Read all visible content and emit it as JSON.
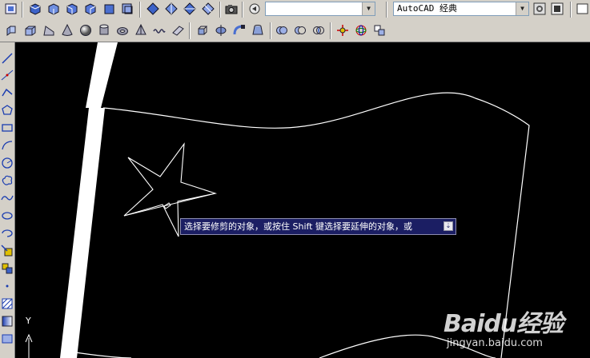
{
  "toolbar": {
    "view_dropdown_value": "",
    "workspace_dropdown_value": "AutoCAD 经典",
    "dropdown_arrow": "▼"
  },
  "icons": {
    "top_row": [
      "view-icon",
      "top-view-icon",
      "bottom-view-icon",
      "left-view-icon",
      "right-view-icon",
      "front-view-icon",
      "back-view-icon",
      "sw-iso-icon",
      "se-iso-icon",
      "ne-iso-icon",
      "nw-iso-icon",
      "camera-icon",
      "orbit-icon",
      "render-settings-icon",
      "layers-icon"
    ],
    "second_row": [
      "polysolid-icon",
      "box-icon",
      "wedge-icon",
      "cone-icon",
      "sphere-icon",
      "cylinder-icon",
      "torus-icon",
      "pyramid-icon",
      "helix-icon",
      "planar-surface-icon",
      "extrude-icon",
      "revolve-icon",
      "sweep-icon",
      "loft-icon",
      "union-icon",
      "subtract-icon",
      "intersect-icon",
      "3d-move-icon",
      "3d-rotate-icon",
      "3d-align-icon"
    ],
    "left_column": [
      "line-icon",
      "construction-line-icon",
      "polyline-icon",
      "polygon-icon",
      "rectangle-icon",
      "arc-icon",
      "circle-icon",
      "revision-cloud-icon",
      "spline-icon",
      "ellipse-icon",
      "ellipse-arc-icon",
      "insert-block-icon",
      "make-block-icon",
      "point-icon",
      "hatch-icon",
      "gradient-icon",
      "region-icon"
    ]
  },
  "tooltip": {
    "text": "选择要修剪的对象，或按住 Shift 键选择要延伸的对象，或",
    "icon_name": "expand-icon",
    "icon_glyph": "⇣"
  },
  "ucs": {
    "axis_label": "Y"
  },
  "watermark": {
    "brand": "Baidu经验",
    "url": "jingyan.baidu.com"
  },
  "colors": {
    "canvas_bg": "#000000",
    "drawing_line": "#ffffff",
    "tooltip_bg": "#1b1e63"
  }
}
